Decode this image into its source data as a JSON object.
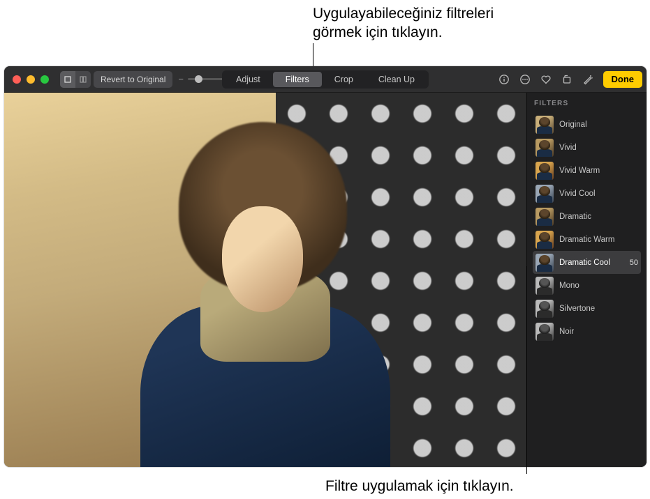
{
  "callouts": {
    "top": "Uygulayabileceğiniz filtreleri\ngörmek için tıklayın.",
    "bottom": "Filtre uygulamak için tıklayın."
  },
  "toolbar": {
    "revert_label": "Revert to Original",
    "tabs": {
      "adjust": "Adjust",
      "filters": "Filters",
      "crop": "Crop",
      "cleanup": "Clean Up"
    },
    "done_label": "Done"
  },
  "panel": {
    "title": "FILTERS",
    "selected_value": "50",
    "filters": [
      {
        "label": "Original"
      },
      {
        "label": "Vivid"
      },
      {
        "label": "Vivid Warm"
      },
      {
        "label": "Vivid Cool"
      },
      {
        "label": "Dramatic"
      },
      {
        "label": "Dramatic Warm"
      },
      {
        "label": "Dramatic Cool"
      },
      {
        "label": "Mono"
      },
      {
        "label": "Silvertone"
      },
      {
        "label": "Noir"
      }
    ]
  }
}
